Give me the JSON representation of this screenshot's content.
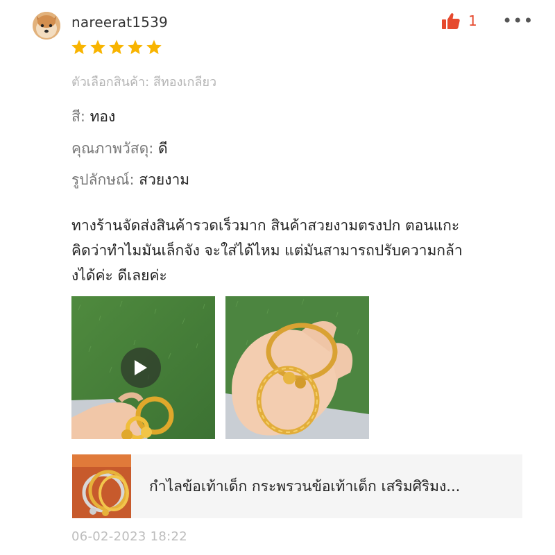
{
  "review": {
    "username": "nareerat1539",
    "like_count": "1",
    "more_label": "•••",
    "rating": 5,
    "variation": "ตัวเลือกสินค้า: สีทองเกลียว",
    "attributes": [
      {
        "key": "สี:",
        "value": "ทอง"
      },
      {
        "key": "คุณภาพวัสดุ:",
        "value": "ดี"
      },
      {
        "key": "รูปลักษณ์:",
        "value": "สวยงาม"
      }
    ],
    "comment": "ทางร้านจัดส่งสินค้ารวดเร็วมาก สินค้าสวยงามตรงปก ตอนแกะ\nคิดว่าทำไมมันเล็กจัง จะใส่ได้ไหม แต่มันสามารถปรับความกล้า\nงได้ค่ะ ดีเลยค่ะ",
    "timestamp": "06-02-2023 18:22"
  },
  "product": {
    "name": "กำไลข้อเท้าเด็ก กระพรวนข้อเท้าเด็ก เสริมศิริมง..."
  },
  "colors": {
    "accent": "#e64a2e",
    "star": "#f8b400",
    "muted": "#b5b5b5",
    "card_bg": "#f5f5f5"
  },
  "icons": {
    "like": "thumbs-up-icon",
    "star": "star-icon",
    "play": "play-icon",
    "more": "more-dots-icon"
  }
}
